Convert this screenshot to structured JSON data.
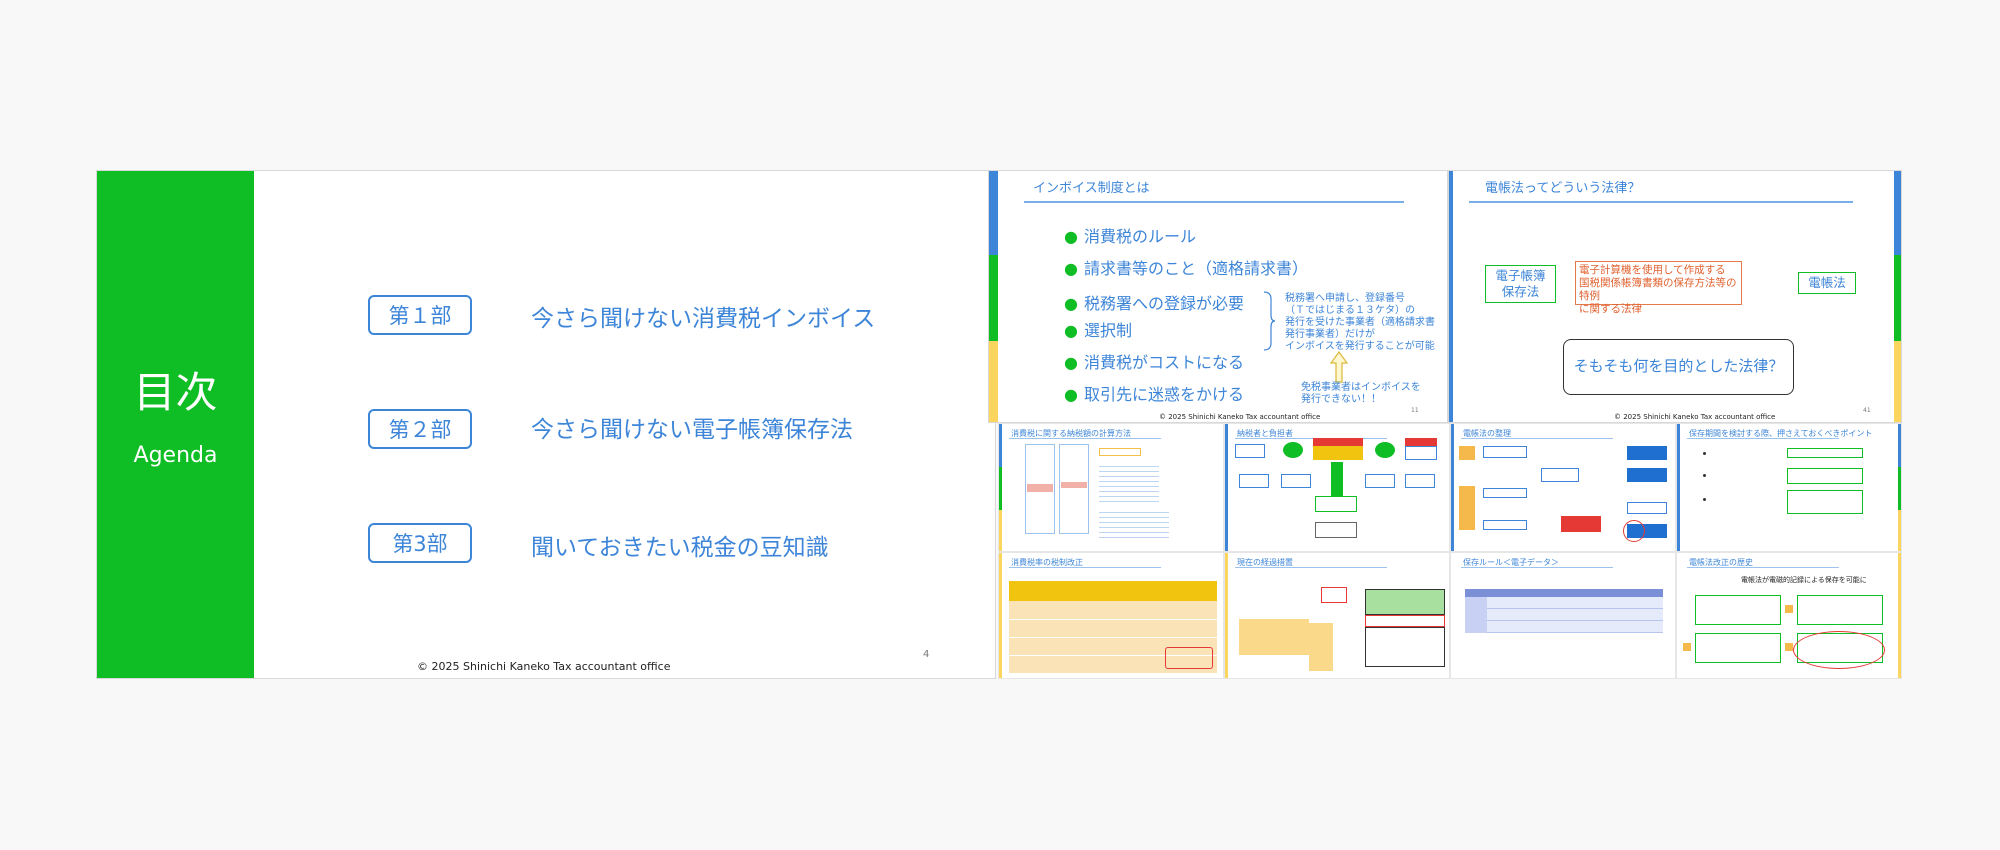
{
  "agenda": {
    "title": "目次",
    "subtitle": "Agenda",
    "parts": [
      {
        "label": "第１部",
        "text": "今さら聞けない消費税インボイス"
      },
      {
        "label": "第２部",
        "text": "今さら聞けない電子帳簿保存法"
      },
      {
        "label": "第3部",
        "text": "聞いておきたい税金の豆知識"
      }
    ],
    "footer": "© 2025 Shinichi Kaneko Tax accountant office",
    "page": "4"
  },
  "slide_invoice": {
    "title": "インボイス制度とは",
    "bullets": [
      "消費税のルール",
      "請求書等のこと（適格請求書）",
      "税務署への登録が必要",
      "選択制",
      "消費税がコストになる",
      "取引先に迷惑をかける"
    ],
    "note1": [
      "税務署へ申請し、登録番号",
      "（Ｔではじまる１３ケタ）の",
      "発行を受けた事業者（適格請求書",
      "発行事業者）だけが",
      "インボイスを発行することが可能"
    ],
    "note2": [
      "免税事業者はインボイスを",
      "発行できない！！"
    ],
    "footer": "© 2025 Shinichi Kaneko Tax accountant office",
    "page": "11"
  },
  "slide_denchoho": {
    "title": "電帳法ってどういう法律？",
    "box_left": [
      "電子帳簿",
      "保存法"
    ],
    "box_mid": [
      "電子計算機を使用して作成する",
      "国税関係帳簿書類の保存方法等の特例",
      "に関する法律"
    ],
    "box_right": "電帳法",
    "question": "そもそも何を目的とした法律？",
    "footer": "© 2025 Shinichi Kaneko Tax accountant office",
    "page": "41"
  },
  "thumbs": [
    {
      "title": "消費税に関する納税額の計算方法"
    },
    {
      "title": "納税者と負担者"
    },
    {
      "title": "電帳法の整理"
    },
    {
      "title": "保存期間を検討する際、押さえておくべきポイント"
    },
    {
      "title": "消費税率の税制改正"
    },
    {
      "title": "現在の経過措置"
    },
    {
      "title": "保存ルール＜電子データ＞"
    },
    {
      "title": "電帳法改正の歴史"
    }
  ],
  "thumb_texts": {
    "t8_heading": "電帳法が電磁的記録による保存を可能に"
  },
  "colors": {
    "green": "#0fbd24",
    "blue": "#3d85d8",
    "yellow": "#fbd55e",
    "red": "#e53935"
  }
}
